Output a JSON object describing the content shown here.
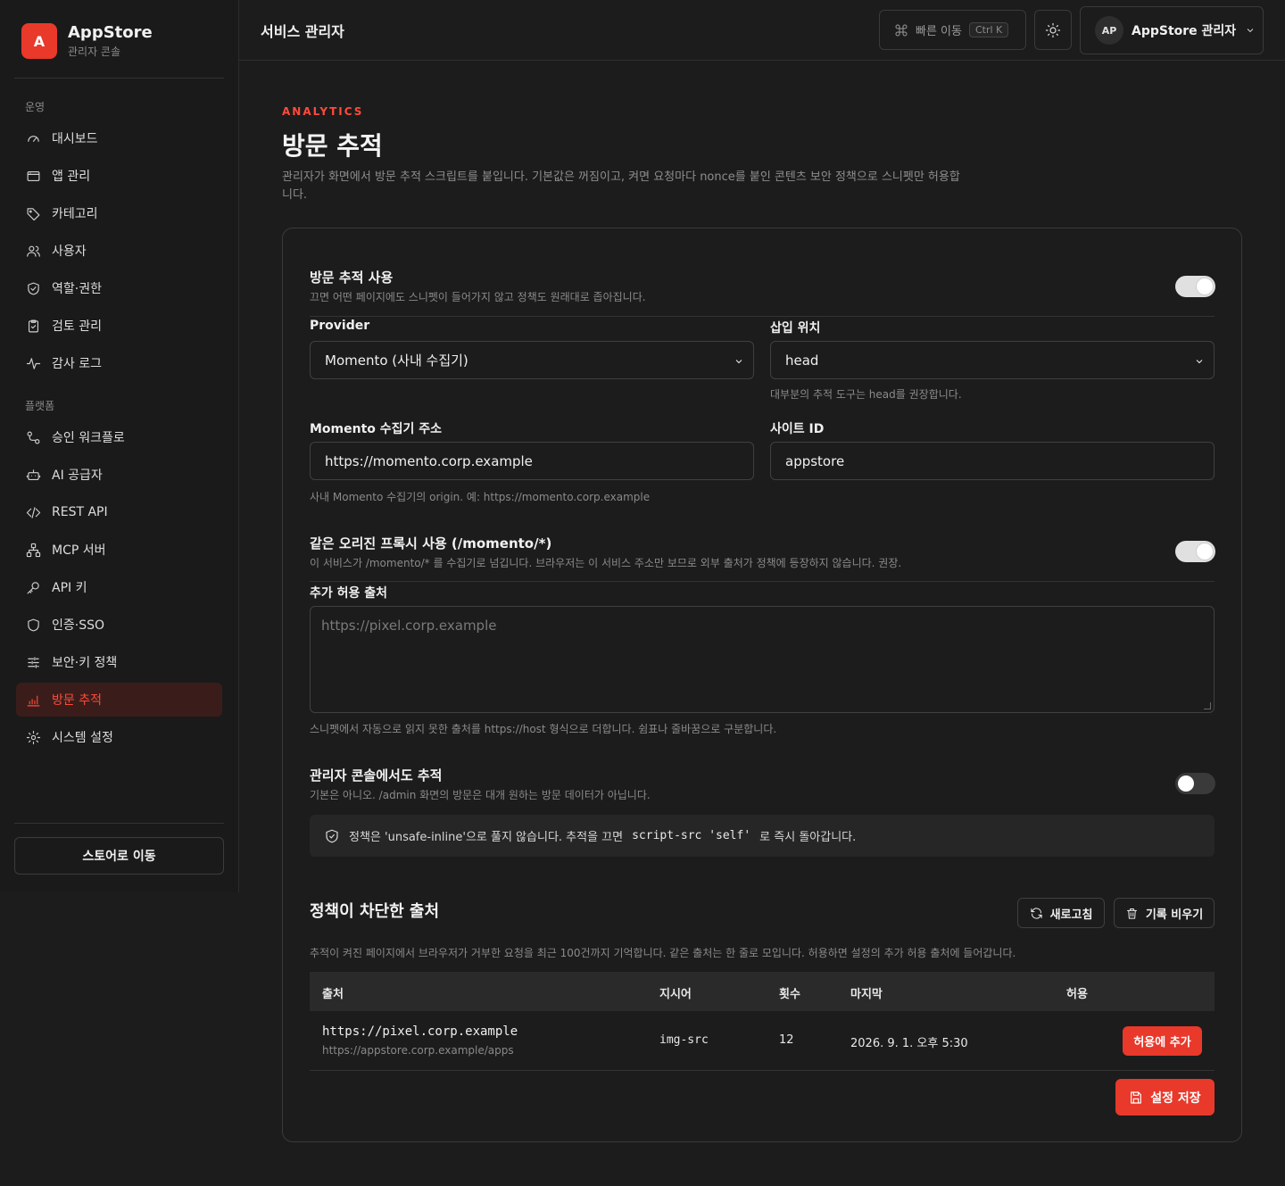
{
  "brand": {
    "logo_letter": "A",
    "name": "AppStore",
    "subtitle": "관리자 콘솔"
  },
  "sidebar": {
    "sections": [
      {
        "label": "운영"
      },
      {
        "label": "플랫폼"
      }
    ],
    "items": [
      {
        "label": "대시보드",
        "icon": "gauge-icon"
      },
      {
        "label": "앱 관리",
        "icon": "window-icon"
      },
      {
        "label": "카테고리",
        "icon": "tag-icon"
      },
      {
        "label": "사용자",
        "icon": "users-icon"
      },
      {
        "label": "역할·권한",
        "icon": "shield-check-icon"
      },
      {
        "label": "검토 관리",
        "icon": "clipboard-check-icon"
      },
      {
        "label": "감사 로그",
        "icon": "activity-icon"
      },
      {
        "label": "승인 워크플로",
        "icon": "workflow-icon"
      },
      {
        "label": "AI 공급자",
        "icon": "bot-icon"
      },
      {
        "label": "REST API",
        "icon": "code-icon"
      },
      {
        "label": "MCP 서버",
        "icon": "network-icon"
      },
      {
        "label": "API 키",
        "icon": "key-icon"
      },
      {
        "label": "인증·SSO",
        "icon": "shield-icon"
      },
      {
        "label": "보안·키 정책",
        "icon": "sliders-icon"
      },
      {
        "label": "방문 추적",
        "icon": "bar-chart-icon",
        "active": true
      },
      {
        "label": "시스템 설정",
        "icon": "gear-icon"
      }
    ],
    "store_button": "스토어로 이동"
  },
  "topbar": {
    "title": "서비스 관리자",
    "quick_nav": "빠른 이동",
    "shortcut": "Ctrl K",
    "user_initials": "AP",
    "user_name": "AppStore 관리자"
  },
  "page": {
    "eyebrow": "ANALYTICS",
    "title": "방문 추적",
    "description": "관리자가 화면에서 방문 추적 스크립트를 붙입니다. 기본값은 꺼짐이고, 켜면 요청마다 nonce를 붙인 콘텐츠 보안 정책으로 스니펫만 허용합니다."
  },
  "settings": {
    "enable": {
      "title": "방문 추적 사용",
      "desc": "끄면 어떤 페이지에도 스니펫이 들어가지 않고 정책도 원래대로 좁아집니다.",
      "on": true
    },
    "provider": {
      "label": "Provider",
      "value": "Momento (사내 수집기)"
    },
    "position": {
      "label": "삽입 위치",
      "value": "head",
      "hint": "대부분의 추적 도구는 head를 권장합니다."
    },
    "collector": {
      "label": "Momento 수집기 주소",
      "value": "https://momento.corp.example",
      "hint": "사내 Momento 수집기의 origin. 예: https://momento.corp.example"
    },
    "site_id": {
      "label": "사이트 ID",
      "value": "appstore"
    },
    "proxy": {
      "title": "같은 오리진 프록시 사용 (/momento/*)",
      "desc": "이 서비스가 /momento/* 를 수집기로 넘깁니다. 브라우저는 이 서비스 주소만 보므로 외부 출처가 정책에 등장하지 않습니다. 권장.",
      "on": true
    },
    "extra_origins": {
      "label": "추가 허용 출처",
      "placeholder": "https://pixel.corp.example",
      "hint": "스니펫에서 자동으로 읽지 못한 출처를 https://host 형식으로 더합니다. 쉼표나 줄바꿈으로 구분합니다."
    },
    "admin_track": {
      "title": "관리자 콘솔에서도 추적",
      "desc": "기본은 아니오. /admin 화면의 방문은 대개 원하는 방문 데이터가 아닙니다.",
      "on": false
    },
    "notice": {
      "before": "정책은 'unsafe-inline'으로 풀지 않습니다. 추적을 끄면",
      "code": "script-src 'self'",
      "after": "로 즉시 돌아갑니다."
    }
  },
  "blocked": {
    "title": "정책이 차단한 출처",
    "refresh": "새로고침",
    "clear": "기록 비우기",
    "desc": "추적이 켜진 페이지에서 브라우저가 거부한 요청을 최근 100건까지 기억합니다. 같은 출처는 한 줄로 모입니다. 허용하면 설정의 추가 허용 출처에 들어갑니다.",
    "columns": [
      "출처",
      "지시어",
      "횟수",
      "마지막",
      "허용"
    ],
    "rows": [
      {
        "origin": "https://pixel.corp.example",
        "page": "https://appstore.corp.example/apps",
        "directive": "img-src",
        "count": "12",
        "last": "2026. 9. 1. 오후 5:30",
        "action": "허용에 추가"
      }
    ]
  },
  "save_button": "설정 저장",
  "colors": {
    "accent": "#e8392b",
    "accent_text": "#ff4a3a",
    "background": "#1c1c1c",
    "sidebar": "#1a1a1a"
  }
}
